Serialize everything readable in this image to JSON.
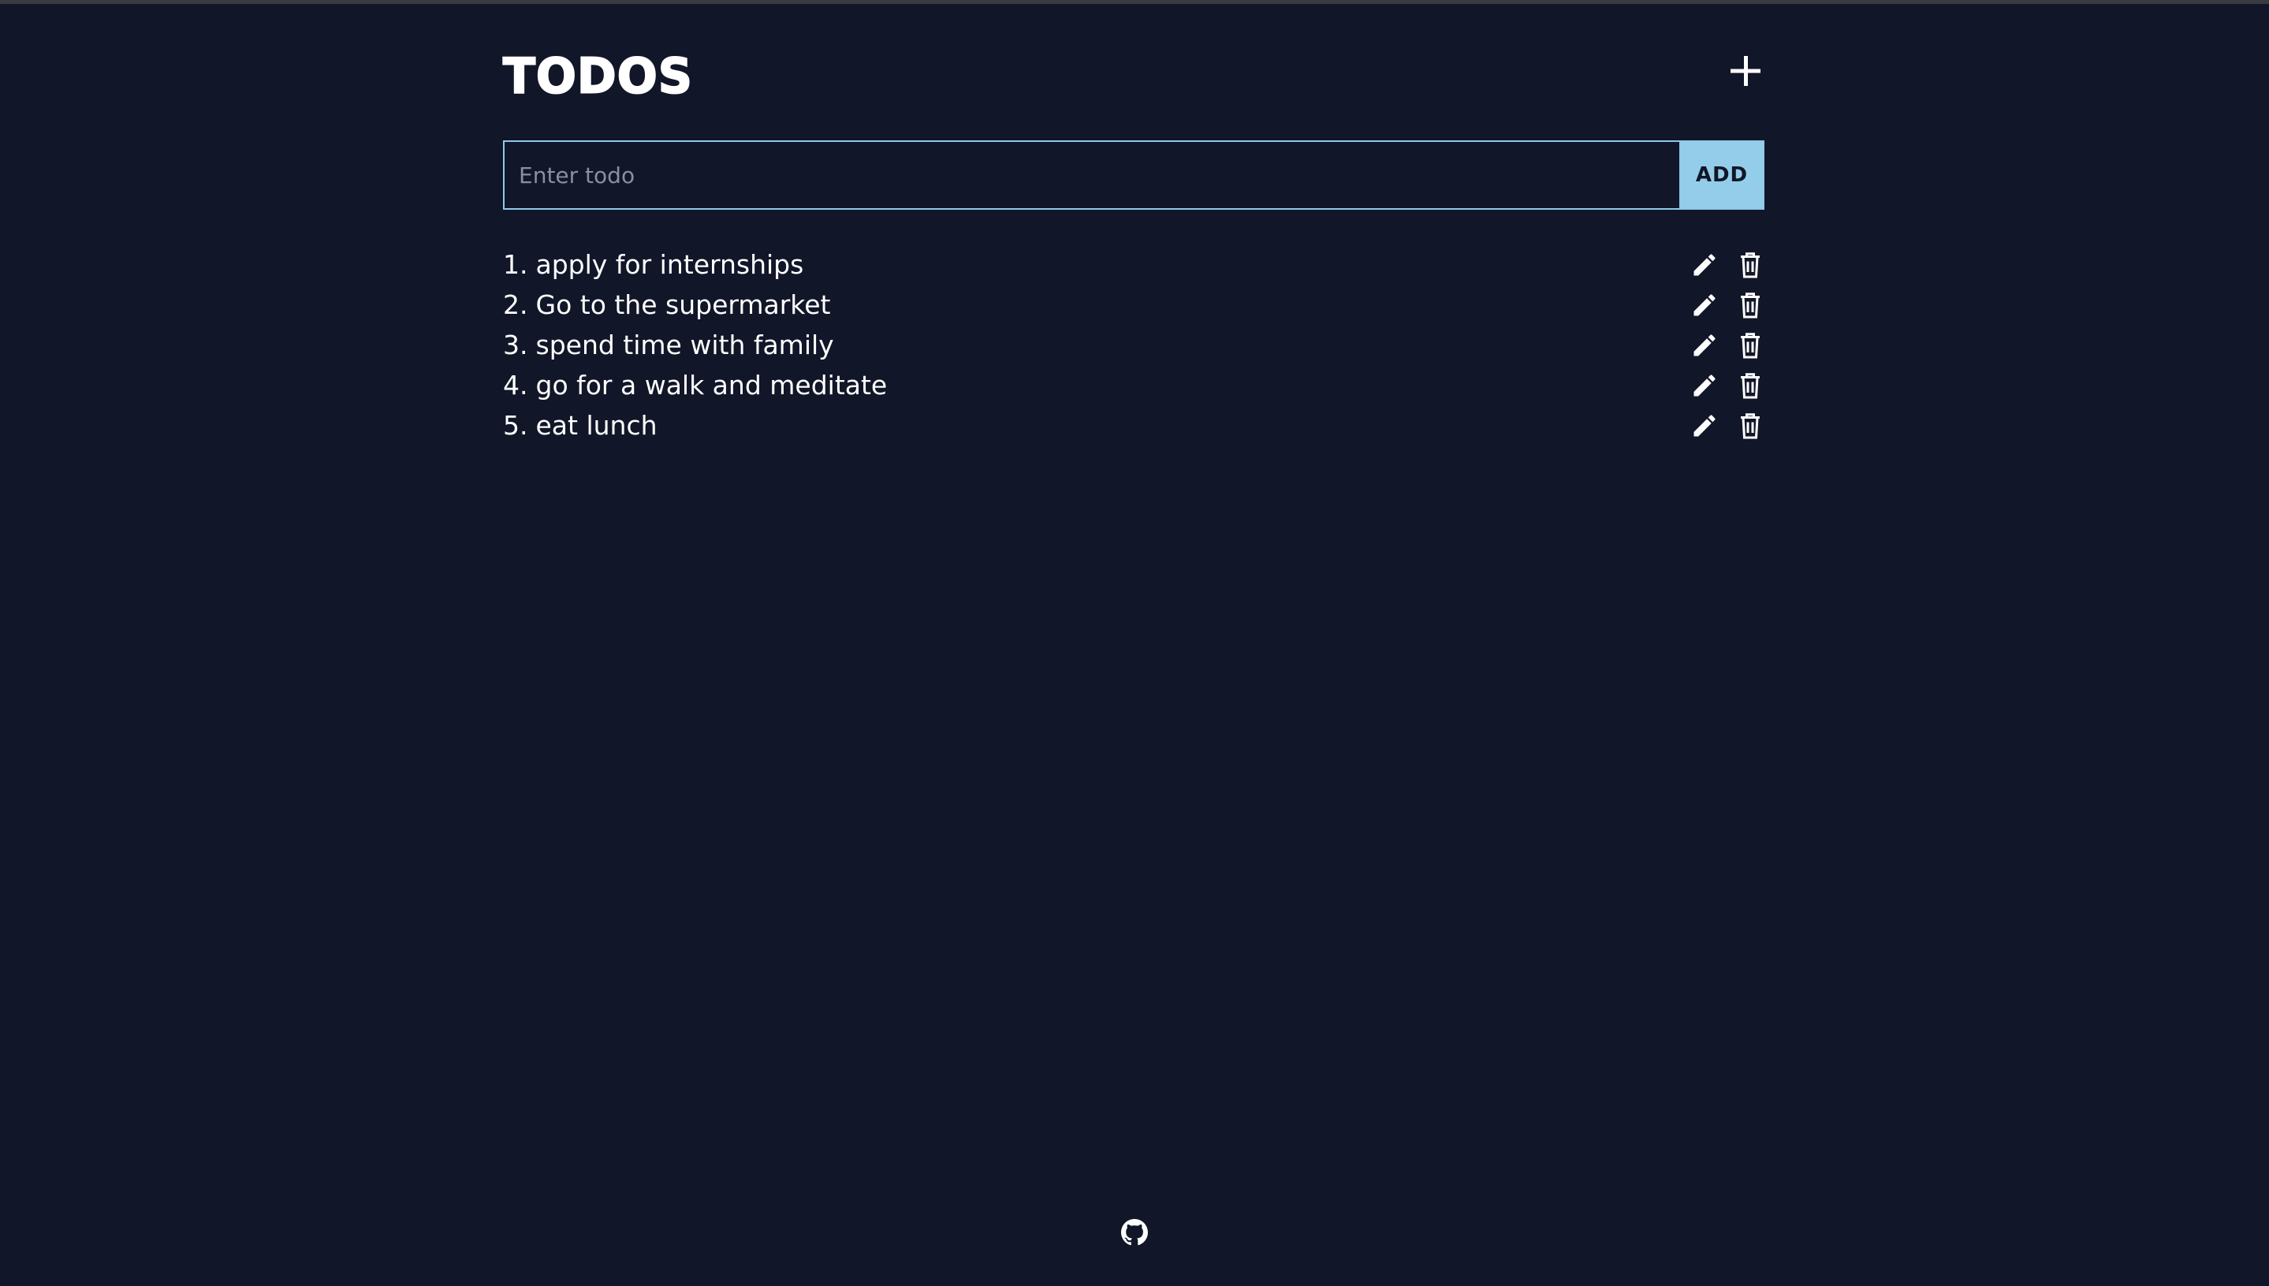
{
  "app": {
    "title": "TODOS"
  },
  "header": {
    "add_toggle_icon": "plus-icon"
  },
  "form": {
    "placeholder": "Enter todo",
    "value": "",
    "add_label": "ADD"
  },
  "todos": [
    {
      "num": "1.",
      "text": "apply for internships"
    },
    {
      "num": "2.",
      "text": "Go to the supermarket"
    },
    {
      "num": "3.",
      "text": "spend time with family"
    },
    {
      "num": "4.",
      "text": "go for a walk and meditate"
    },
    {
      "num": "5.",
      "text": "eat lunch"
    }
  ],
  "item_icons": {
    "edit": "pencil-icon",
    "delete": "trash-icon"
  },
  "footer": {
    "icon": "github-icon"
  },
  "colors": {
    "background": "#111628",
    "accent": "#94cde9",
    "text": "#ffffff",
    "placeholder": "#8a8f9e"
  }
}
